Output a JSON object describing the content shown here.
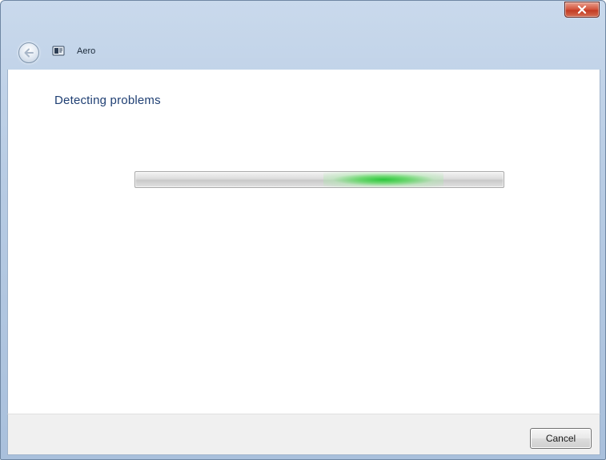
{
  "window": {
    "title": "Aero",
    "accent_color": "#1f3f73",
    "close_color": "#c23b22",
    "progress_color": "#2cc83c"
  },
  "titlebar": {
    "back_icon": "back-arrow-icon",
    "app_icon": "aero-app-icon",
    "close_icon": "close-icon"
  },
  "main": {
    "heading": "Detecting problems",
    "progress": {
      "state": "indeterminate"
    }
  },
  "footer": {
    "cancel_label": "Cancel"
  }
}
